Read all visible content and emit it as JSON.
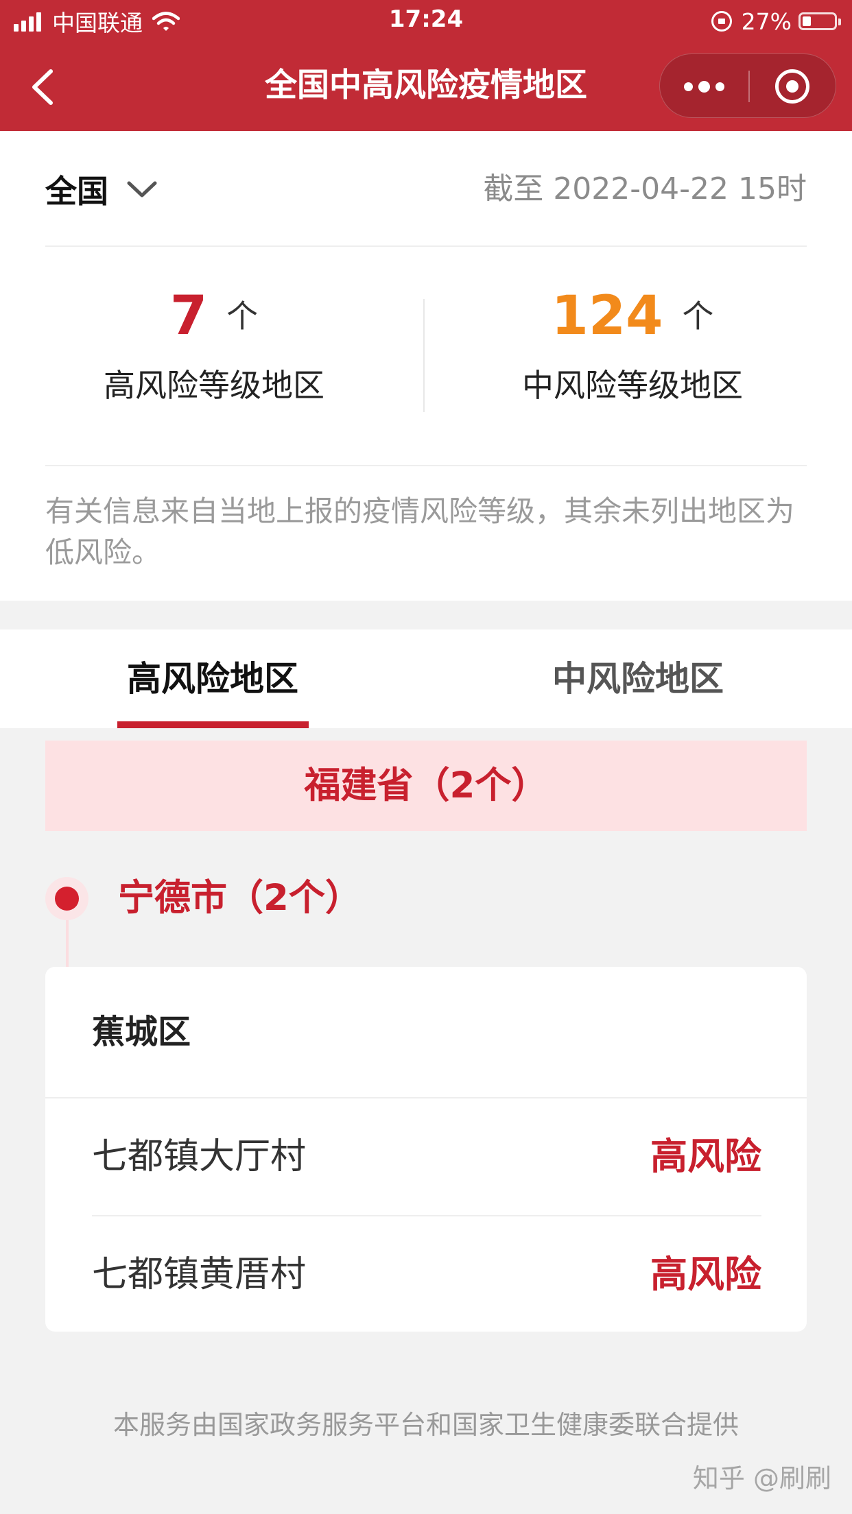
{
  "status_bar": {
    "carrier": "中国联通",
    "time": "17:24",
    "battery_percent": "27%",
    "battery_level": 0.27,
    "icons": [
      "signal-icon",
      "wifi-icon",
      "rotation-lock-icon",
      "battery-icon"
    ]
  },
  "nav": {
    "title": "全国中高风险疫情地区",
    "icons": [
      "back-icon",
      "more-icon",
      "close-mini-program-icon"
    ]
  },
  "summary": {
    "region": "全国",
    "updated": "截至 2022-04-22 15时",
    "high": {
      "count": "7",
      "unit": "个",
      "label": "高风险等级地区"
    },
    "medium": {
      "count": "124",
      "unit": "个",
      "label": "中风险等级地区"
    },
    "note": "有关信息来自当地上报的疫情风险等级，其余未列出地区为低风险。"
  },
  "tabs": [
    {
      "label": "高风险地区",
      "active": true
    },
    {
      "label": "中风险地区",
      "active": false
    }
  ],
  "province": {
    "label": "福建省（2个）"
  },
  "city": {
    "label": "宁德市（2个）"
  },
  "district": {
    "name": "蕉城区",
    "places": [
      {
        "name": "七都镇大厅村",
        "risk": "高风险"
      },
      {
        "name": "七都镇黄厝村",
        "risk": "高风险"
      }
    ]
  },
  "footer": "本服务由国家政务服务平台和国家卫生健康委联合提供",
  "watermark": "知乎 @刷刷",
  "colors": {
    "header": "#c12b36",
    "high_risk": "#c8202e",
    "medium_risk": "#f28a1b",
    "province_bg": "#fde1e3"
  }
}
